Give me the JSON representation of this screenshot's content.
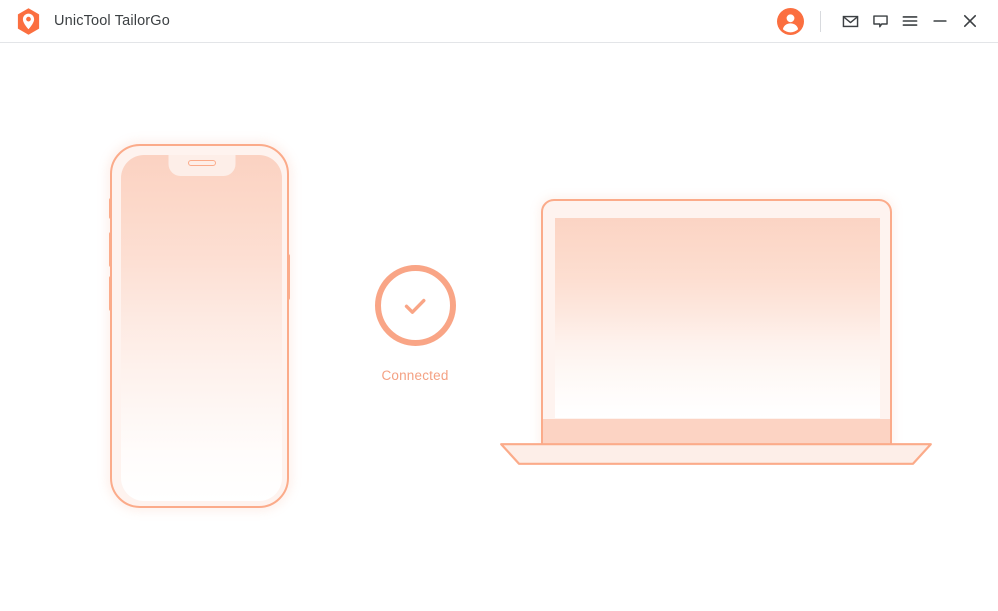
{
  "window": {
    "title": "UnicTool TailorGo",
    "brand_color": "#fb6f40",
    "accent_color": "#f9a586",
    "title_color": "#3c4043",
    "logo_icon": "location-pin-hexagon-logo"
  },
  "titlebar": {
    "avatar_icon": "user-account-icon",
    "actions": [
      {
        "name": "mail-icon",
        "label": "Mail"
      },
      {
        "name": "feedback-icon",
        "label": "Feedback"
      },
      {
        "name": "menu-icon",
        "label": "Menu"
      }
    ],
    "window_controls": [
      {
        "name": "minimize-button",
        "label": "Minimize"
      },
      {
        "name": "close-button",
        "label": "Close"
      }
    ]
  },
  "main": {
    "phone": {
      "device_icon": "smartphone-illustration",
      "notch": "phone-notch",
      "speaker": "phone-earpiece-speaker"
    },
    "status": {
      "icon": "check-circle-icon",
      "label": "Connected",
      "color": "#f4a183"
    },
    "laptop": {
      "device_icon": "laptop-illustration"
    }
  }
}
